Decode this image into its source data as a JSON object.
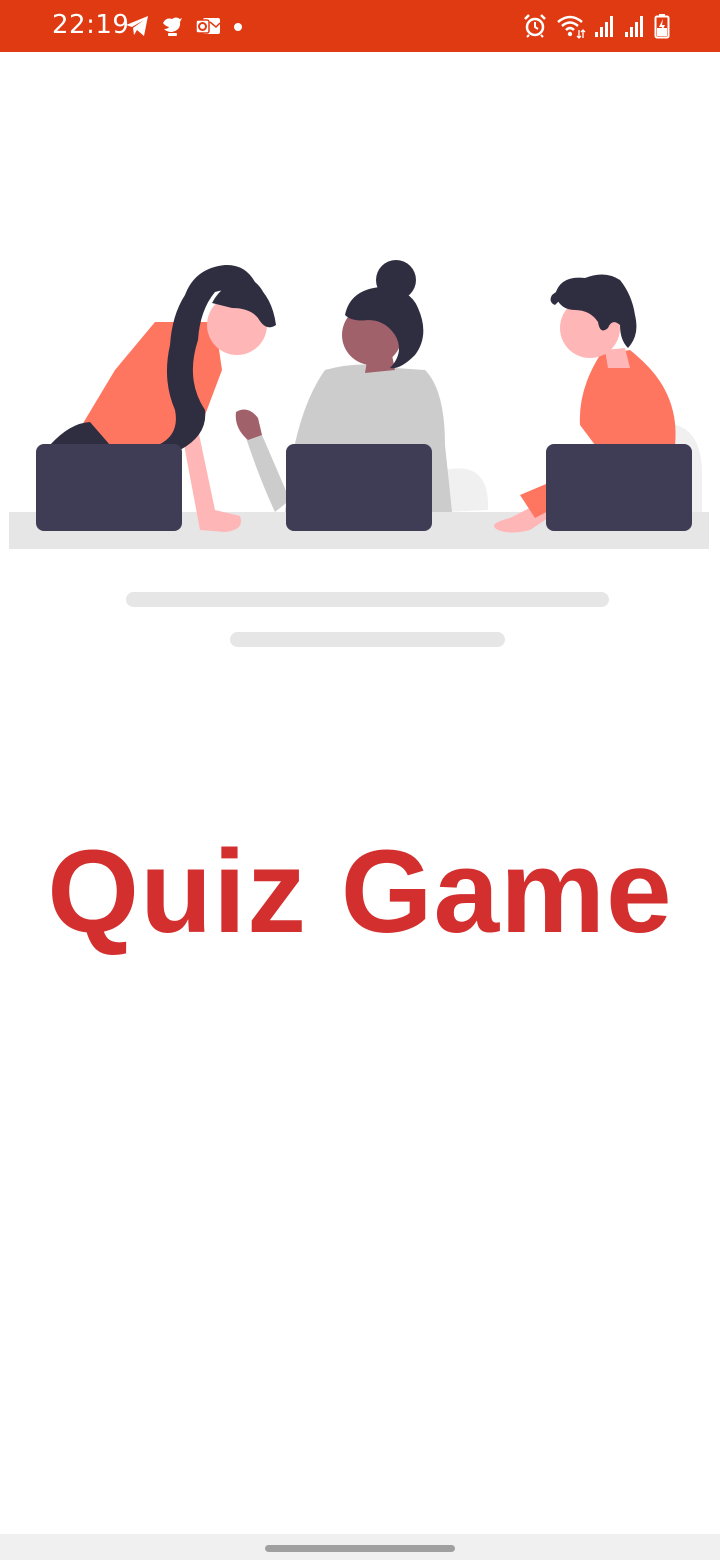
{
  "status_bar": {
    "time": "22:19",
    "background_color": "#e03a12",
    "left_icons": [
      "telegram-icon",
      "bird-app-icon",
      "outlook-icon",
      "notification-dot-icon"
    ],
    "right_icons": [
      "alarm-icon",
      "wifi-icon",
      "signal-icon-1",
      "signal-icon-2",
      "battery-charging-icon"
    ]
  },
  "illustration": {
    "description_icon": "team-working-on-laptops-illustration",
    "colors": {
      "accent": "#ff7660",
      "laptop": "#3f3d56",
      "hair": "#2f2e41",
      "skin_light": "#ffb6b6",
      "skin_dark": "#a0616a",
      "shirt_gray": "#cccccc",
      "desk": "#e6e6e6"
    }
  },
  "main": {
    "title": "Quiz Game",
    "title_color": "#d32f2f"
  }
}
